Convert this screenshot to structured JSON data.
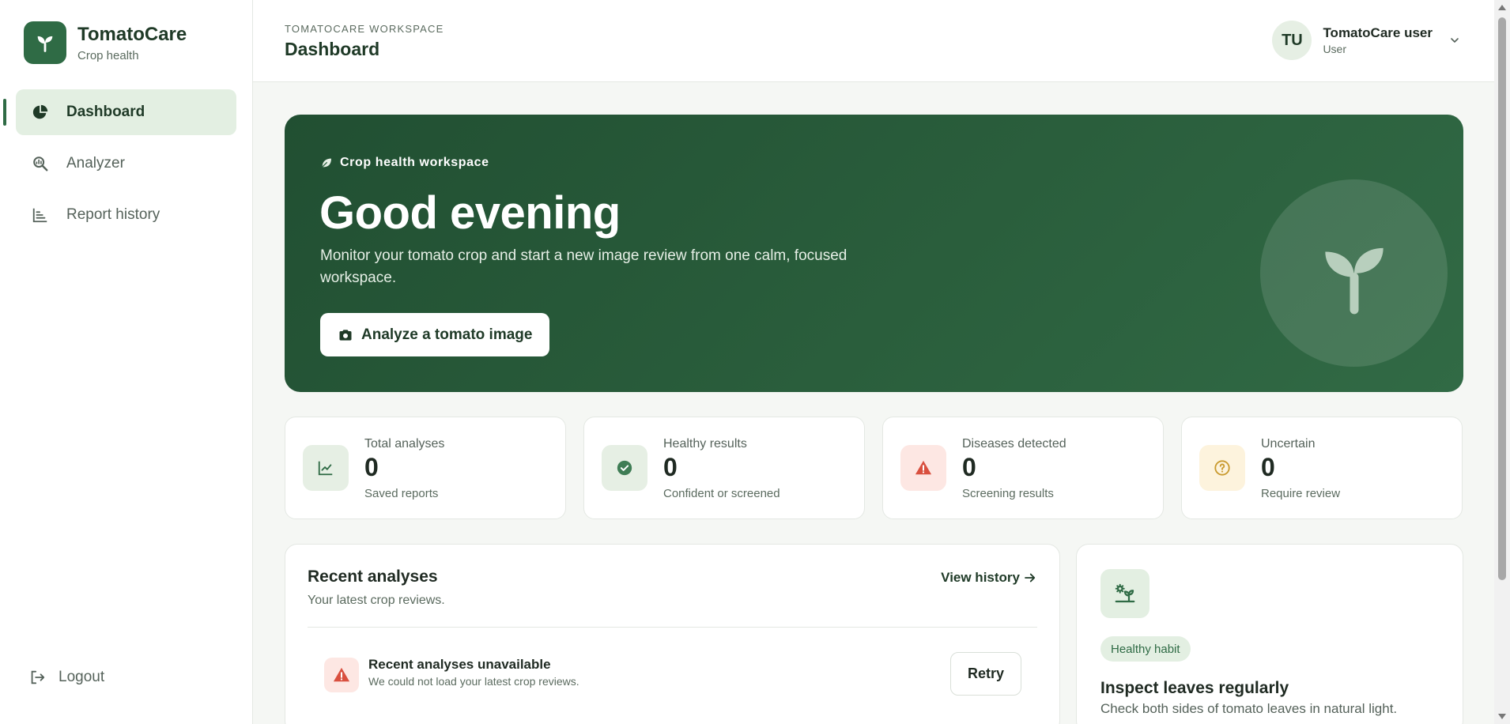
{
  "brand": {
    "name": "TomatoCare",
    "subtitle": "Crop health"
  },
  "sidebar": {
    "items": [
      {
        "label": "Dashboard",
        "icon": "pie-chart-icon",
        "active": true
      },
      {
        "label": "Analyzer",
        "icon": "magnifier-analyze-icon",
        "active": false
      },
      {
        "label": "Report history",
        "icon": "bar-list-icon",
        "active": false
      }
    ],
    "logout_label": "Logout"
  },
  "header": {
    "workspace_label": "TOMATOCARE WORKSPACE",
    "title": "Dashboard",
    "user": {
      "initials": "TU",
      "name": "TomatoCare user",
      "role": "User"
    }
  },
  "hero": {
    "kicker": "Crop health workspace",
    "title": "Good evening",
    "description": "Monitor your tomato crop and start a new image review from one calm, focused workspace.",
    "button_label": "Analyze a tomato image"
  },
  "stats": [
    {
      "label": "Total analyses",
      "value": "0",
      "sub": "Saved reports",
      "icon": "trend-chart-icon",
      "bg": "#e6efe4",
      "fg": "#2f6b45"
    },
    {
      "label": "Healthy results",
      "value": "0",
      "sub": "Confident or screened",
      "icon": "check-circle-icon",
      "bg": "#e6efe4",
      "fg": "#2f6b45"
    },
    {
      "label": "Diseases detected",
      "value": "0",
      "sub": "Screening results",
      "icon": "warning-icon",
      "bg": "#fde7e3",
      "fg": "#d9503f"
    },
    {
      "label": "Uncertain",
      "value": "0",
      "sub": "Require review",
      "icon": "question-circle-icon",
      "bg": "#fdf3dd",
      "fg": "#c99a2e"
    }
  ],
  "recent": {
    "title": "Recent analyses",
    "subtitle": "Your latest crop reviews.",
    "view_history_label": "View history",
    "error_title": "Recent analyses unavailable",
    "error_text": "We could not load your latest crop reviews.",
    "retry_label": "Retry"
  },
  "tip": {
    "badge": "Healthy habit",
    "title": "Inspect leaves regularly",
    "text": "Check both sides of tomato leaves in natural light."
  },
  "colors": {
    "brand": "#2f6b45",
    "hero_bg": "#25553a",
    "danger": "#d9503f",
    "warning": "#c99a2e"
  }
}
